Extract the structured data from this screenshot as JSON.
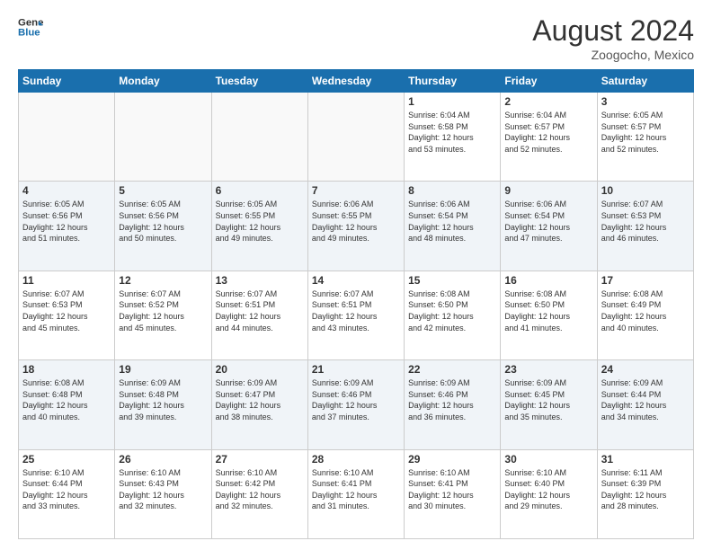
{
  "header": {
    "logo_line1": "General",
    "logo_line2": "Blue",
    "month_year": "August 2024",
    "location": "Zoogocho, Mexico"
  },
  "days_of_week": [
    "Sunday",
    "Monday",
    "Tuesday",
    "Wednesday",
    "Thursday",
    "Friday",
    "Saturday"
  ],
  "weeks": [
    [
      {
        "day": "",
        "text": ""
      },
      {
        "day": "",
        "text": ""
      },
      {
        "day": "",
        "text": ""
      },
      {
        "day": "",
        "text": ""
      },
      {
        "day": "1",
        "text": "Sunrise: 6:04 AM\nSunset: 6:58 PM\nDaylight: 12 hours\nand 53 minutes."
      },
      {
        "day": "2",
        "text": "Sunrise: 6:04 AM\nSunset: 6:57 PM\nDaylight: 12 hours\nand 52 minutes."
      },
      {
        "day": "3",
        "text": "Sunrise: 6:05 AM\nSunset: 6:57 PM\nDaylight: 12 hours\nand 52 minutes."
      }
    ],
    [
      {
        "day": "4",
        "text": "Sunrise: 6:05 AM\nSunset: 6:56 PM\nDaylight: 12 hours\nand 51 minutes."
      },
      {
        "day": "5",
        "text": "Sunrise: 6:05 AM\nSunset: 6:56 PM\nDaylight: 12 hours\nand 50 minutes."
      },
      {
        "day": "6",
        "text": "Sunrise: 6:05 AM\nSunset: 6:55 PM\nDaylight: 12 hours\nand 49 minutes."
      },
      {
        "day": "7",
        "text": "Sunrise: 6:06 AM\nSunset: 6:55 PM\nDaylight: 12 hours\nand 49 minutes."
      },
      {
        "day": "8",
        "text": "Sunrise: 6:06 AM\nSunset: 6:54 PM\nDaylight: 12 hours\nand 48 minutes."
      },
      {
        "day": "9",
        "text": "Sunrise: 6:06 AM\nSunset: 6:54 PM\nDaylight: 12 hours\nand 47 minutes."
      },
      {
        "day": "10",
        "text": "Sunrise: 6:07 AM\nSunset: 6:53 PM\nDaylight: 12 hours\nand 46 minutes."
      }
    ],
    [
      {
        "day": "11",
        "text": "Sunrise: 6:07 AM\nSunset: 6:53 PM\nDaylight: 12 hours\nand 45 minutes."
      },
      {
        "day": "12",
        "text": "Sunrise: 6:07 AM\nSunset: 6:52 PM\nDaylight: 12 hours\nand 45 minutes."
      },
      {
        "day": "13",
        "text": "Sunrise: 6:07 AM\nSunset: 6:51 PM\nDaylight: 12 hours\nand 44 minutes."
      },
      {
        "day": "14",
        "text": "Sunrise: 6:07 AM\nSunset: 6:51 PM\nDaylight: 12 hours\nand 43 minutes."
      },
      {
        "day": "15",
        "text": "Sunrise: 6:08 AM\nSunset: 6:50 PM\nDaylight: 12 hours\nand 42 minutes."
      },
      {
        "day": "16",
        "text": "Sunrise: 6:08 AM\nSunset: 6:50 PM\nDaylight: 12 hours\nand 41 minutes."
      },
      {
        "day": "17",
        "text": "Sunrise: 6:08 AM\nSunset: 6:49 PM\nDaylight: 12 hours\nand 40 minutes."
      }
    ],
    [
      {
        "day": "18",
        "text": "Sunrise: 6:08 AM\nSunset: 6:48 PM\nDaylight: 12 hours\nand 40 minutes."
      },
      {
        "day": "19",
        "text": "Sunrise: 6:09 AM\nSunset: 6:48 PM\nDaylight: 12 hours\nand 39 minutes."
      },
      {
        "day": "20",
        "text": "Sunrise: 6:09 AM\nSunset: 6:47 PM\nDaylight: 12 hours\nand 38 minutes."
      },
      {
        "day": "21",
        "text": "Sunrise: 6:09 AM\nSunset: 6:46 PM\nDaylight: 12 hours\nand 37 minutes."
      },
      {
        "day": "22",
        "text": "Sunrise: 6:09 AM\nSunset: 6:46 PM\nDaylight: 12 hours\nand 36 minutes."
      },
      {
        "day": "23",
        "text": "Sunrise: 6:09 AM\nSunset: 6:45 PM\nDaylight: 12 hours\nand 35 minutes."
      },
      {
        "day": "24",
        "text": "Sunrise: 6:09 AM\nSunset: 6:44 PM\nDaylight: 12 hours\nand 34 minutes."
      }
    ],
    [
      {
        "day": "25",
        "text": "Sunrise: 6:10 AM\nSunset: 6:44 PM\nDaylight: 12 hours\nand 33 minutes."
      },
      {
        "day": "26",
        "text": "Sunrise: 6:10 AM\nSunset: 6:43 PM\nDaylight: 12 hours\nand 32 minutes."
      },
      {
        "day": "27",
        "text": "Sunrise: 6:10 AM\nSunset: 6:42 PM\nDaylight: 12 hours\nand 32 minutes."
      },
      {
        "day": "28",
        "text": "Sunrise: 6:10 AM\nSunset: 6:41 PM\nDaylight: 12 hours\nand 31 minutes."
      },
      {
        "day": "29",
        "text": "Sunrise: 6:10 AM\nSunset: 6:41 PM\nDaylight: 12 hours\nand 30 minutes."
      },
      {
        "day": "30",
        "text": "Sunrise: 6:10 AM\nSunset: 6:40 PM\nDaylight: 12 hours\nand 29 minutes."
      },
      {
        "day": "31",
        "text": "Sunrise: 6:11 AM\nSunset: 6:39 PM\nDaylight: 12 hours\nand 28 minutes."
      }
    ]
  ]
}
